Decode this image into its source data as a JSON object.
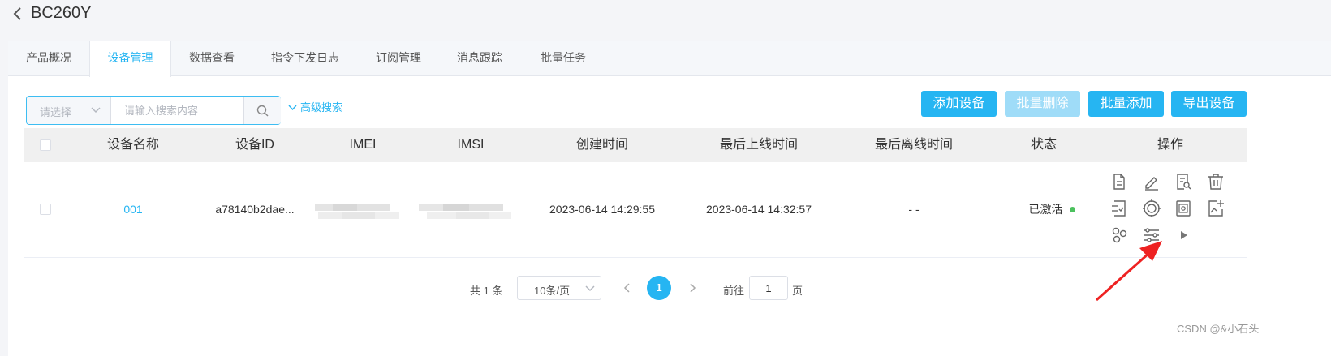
{
  "header": {
    "title": "BC260Y"
  },
  "tabs": [
    {
      "label": "产品概况"
    },
    {
      "label": "设备管理",
      "active": true
    },
    {
      "label": "数据查看"
    },
    {
      "label": "指令下发日志"
    },
    {
      "label": "订阅管理"
    },
    {
      "label": "消息跟踪"
    },
    {
      "label": "批量任务"
    }
  ],
  "search": {
    "select_placeholder": "请选择",
    "input_placeholder": "请输入搜索内容",
    "advanced_label": "高级搜索"
  },
  "toolbar": {
    "add_label": "添加设备",
    "batch_delete_label": "批量删除",
    "batch_add_label": "批量添加",
    "export_label": "导出设备"
  },
  "table": {
    "columns": [
      "设备名称",
      "设备ID",
      "IMEI",
      "IMSI",
      "创建时间",
      "最后上线时间",
      "最后离线时间",
      "状态",
      "操作"
    ],
    "rows": [
      {
        "name": "001",
        "device_id": "a78140b2dae...",
        "imei": "",
        "imsi": "",
        "created": "2023-06-14 14:29:55",
        "last_online": "2023-06-14 14:32:57",
        "last_offline": "- -",
        "status": "已激活"
      }
    ],
    "action_icons": [
      "document-icon",
      "edit-icon",
      "search-document-icon",
      "trash-icon",
      "command-list-icon",
      "target-icon",
      "safe-icon",
      "image-edit-icon",
      "topology-icon",
      "settings-sliders-icon",
      "play-icon"
    ]
  },
  "pagination": {
    "total": "共 1 条",
    "page_size": "10条/页",
    "current": "1",
    "goto_label": "前往",
    "goto_value": "1",
    "page_label": "页"
  },
  "colors": {
    "accent": "#26b5f2",
    "disabled": "#9fdcf8",
    "status_active": "#4cc15e",
    "annotation_arrow": "#ee2222"
  },
  "watermark": "CSDN @&小石头"
}
